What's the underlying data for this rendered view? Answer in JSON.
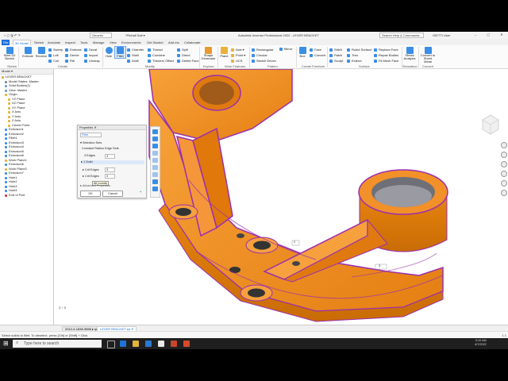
{
  "app": {
    "title": "Autodesk Inventor Professional 2022 - LEVER BRACKET",
    "quick_access": "⌂ ▢ 🖫 ↶ ↷",
    "project": "Generic",
    "file_state": "*Pinball Salt ▾",
    "search_placeholder": "Search Help & Commands...",
    "user": "GIETTI User",
    "window_controls": "– ▢ ✕"
  },
  "tabs": [
    {
      "label": "File"
    },
    {
      "label": "3D Model"
    },
    {
      "label": "Sketch"
    },
    {
      "label": "Annotate"
    },
    {
      "label": "Inspect"
    },
    {
      "label": "Tools"
    },
    {
      "label": "Manage"
    },
    {
      "label": "View"
    },
    {
      "label": "Environments"
    },
    {
      "label": "Get Started"
    },
    {
      "label": "Add-Ins"
    },
    {
      "label": "Collaborate"
    }
  ],
  "ribbon": {
    "start_sketch": "Start 2D Sketch",
    "extrude": "Extrude",
    "revolve": "Revolve",
    "col1": [
      "Sweep",
      "Loft",
      "Coil"
    ],
    "col2": [
      "Emboss",
      "Derive",
      "Rib"
    ],
    "col3": [
      "Decal",
      "Import",
      "Unwrap"
    ],
    "hole": "Hole",
    "fillet": "Fillet",
    "col4": [
      "Chamfer",
      "Shell",
      "Draft"
    ],
    "col5": [
      "Thread",
      "Combine",
      "Thicken/ Offset"
    ],
    "col6": [
      "Split",
      "Direct",
      "Delete Face"
    ],
    "shape_generator": "Shape Generator",
    "plane": "Plane",
    "col7": [
      "Axis ▾",
      "Point ▾",
      "UCS"
    ],
    "col8": [
      "Rectangular",
      "Circular",
      "Sketch Driven"
    ],
    "mirror": "Mirror",
    "box": "Box",
    "col9": [
      "Face",
      "Convert"
    ],
    "col10": [
      "Stitch",
      "Patch",
      "Sculpt"
    ],
    "col11": [
      "Ruled Surface",
      "Trim",
      "Extend"
    ],
    "col12": [
      "Replace Face",
      "Repair Bodies",
      "Fit Mesh Face"
    ],
    "stress_analysis": "Stress Analysis",
    "convert_sheet_metal": "Convert to Sheet Metal",
    "groups": [
      "Sketch",
      "Create",
      "Modify",
      "Explore",
      "Work Features",
      "Pattern",
      "Create Freeform",
      "Surface",
      "Simulation",
      "Convert"
    ]
  },
  "browser": {
    "header": "Model ▾",
    "items": [
      "LEVER BRACKET",
      "Model States: Master",
      "Solid Bodies(1)",
      "View: Master",
      "Origin",
      "YZ Plane",
      "XZ Plane",
      "XY Plane",
      "X Axis",
      "Y Axis",
      "Z Axis",
      "Center Point",
      "Extrusion1",
      "Extrusion2",
      "Fillet1",
      "Extrusion3",
      "Extrusion4",
      "Extrusion5",
      "Extrusion6",
      "Work Plane1",
      "Extrusion6",
      "Work Plane2",
      "Extrusion7",
      "Hole1",
      "Hole2",
      "Hole3",
      "Hole4",
      "End of Part"
    ]
  },
  "fillet_panel": {
    "title": "Properties ✕",
    "name_field": "Fillet",
    "section": "Selection Sets",
    "type": "Constant Radius Edge Sets",
    "edges_label": "3 Edges",
    "radius_value": "3",
    "set1": "1 Solid",
    "set2": "Crit Edges",
    "set2_value": "3",
    "set3": "Crit Edges",
    "set3_value": "3",
    "tooltip": "All rounds",
    "advanced": "Advanced Properties",
    "ok": "OK",
    "cancel": "Cancel",
    "plus": "+"
  },
  "viewport": {
    "dim1": "2",
    "dim2": "3",
    "axes": "Z ↑ X"
  },
  "doc_tabs": [
    "2012-4-1836-9856 ▸ ipt",
    "LEVER BRACKET.ipt ✕"
  ],
  "status": {
    "message": "Select solids to fillet. To deselect, press [Ctrl] or [Shift] + Click.",
    "right": "1   1"
  },
  "taskbar": {
    "search": "Type here to search",
    "time": "9:10 AM",
    "date": "4/7/2022"
  },
  "colors": {
    "part_orange": "#f28c1e",
    "edge_purple": "#9b2fae",
    "hole_gray": "#6f6f78",
    "accent_blue": "#1e6fd9"
  }
}
